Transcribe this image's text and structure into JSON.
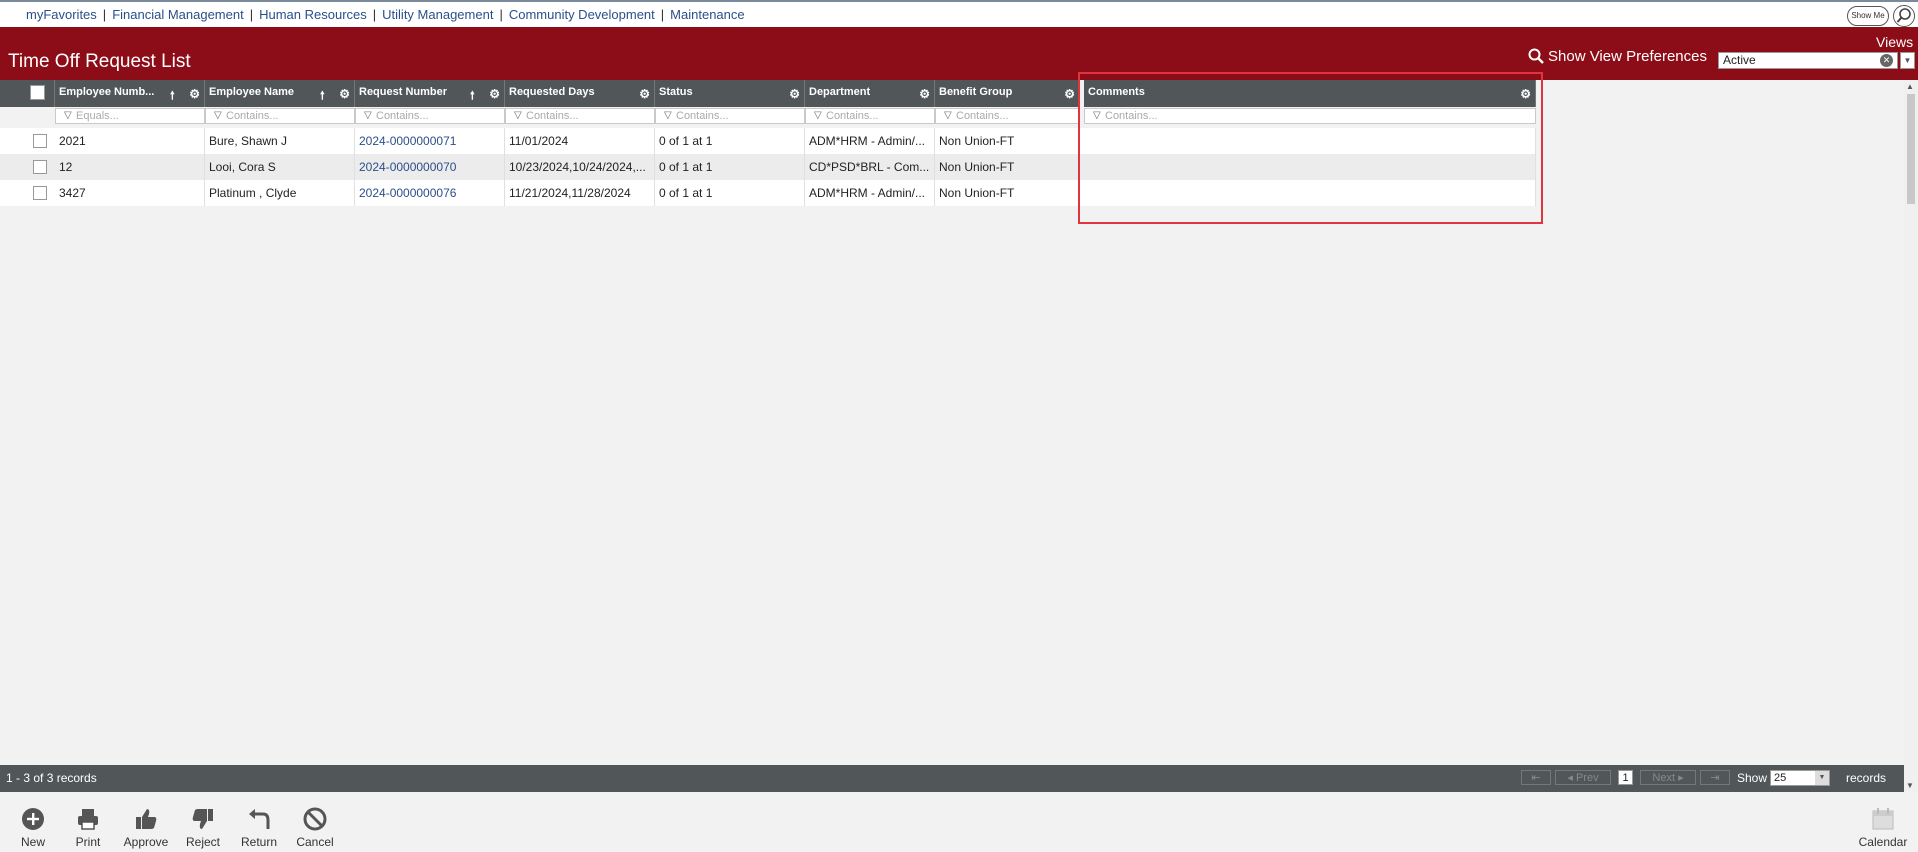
{
  "topnav": {
    "links": [
      "myFavorites",
      "Financial Management",
      "Human Resources",
      "Utility Management",
      "Community Development",
      "Maintenance"
    ],
    "show_me": "Show Me"
  },
  "header": {
    "page_title": "Time Off Request List",
    "views_label": "Views",
    "show_view_preferences": "Show View Preferences",
    "view_selected": "Active"
  },
  "grid": {
    "columns": [
      {
        "label": "Employee Numb...",
        "filter_placeholder": "Equals..."
      },
      {
        "label": "Employee Name",
        "filter_placeholder": "Contains..."
      },
      {
        "label": "Request Number",
        "filter_placeholder": "Contains..."
      },
      {
        "label": "Requested Days",
        "filter_placeholder": "Contains..."
      },
      {
        "label": "Status",
        "filter_placeholder": "Contains..."
      },
      {
        "label": "Department",
        "filter_placeholder": "Contains..."
      },
      {
        "label": "Benefit Group",
        "filter_placeholder": "Contains..."
      },
      {
        "label": "Comments",
        "filter_placeholder": "Contains..."
      }
    ],
    "rows": [
      {
        "employee_number": "2021",
        "employee_name": "Bure, Shawn J",
        "request_number": "2024-0000000071",
        "requested_days": "11/01/2024",
        "status": "0 of 1 at 1",
        "department": "ADM*HRM - Admin/...",
        "benefit_group": "Non Union-FT",
        "comments": ""
      },
      {
        "employee_number": "12",
        "employee_name": "Looi, Cora S",
        "request_number": "2024-0000000070",
        "requested_days": "10/23/2024,10/24/2024,...",
        "status": "0 of 1 at 1",
        "department": "CD*PSD*BRL - Com...",
        "benefit_group": "Non Union-FT",
        "comments": ""
      },
      {
        "employee_number": "3427",
        "employee_name": "Platinum , Clyde",
        "request_number": "2024-0000000076",
        "requested_days": "11/21/2024,11/28/2024",
        "status": "0 of 1 at 1",
        "department": "ADM*HRM - Admin/...",
        "benefit_group": "Non Union-FT",
        "comments": ""
      }
    ]
  },
  "footer": {
    "record_count": "1 - 3 of 3 records",
    "prev": "Prev",
    "next": "Next",
    "current_page": "1",
    "show_label": "Show",
    "page_size": "25",
    "records_label": "records"
  },
  "toolbar": {
    "new": "New",
    "print": "Print",
    "approve": "Approve",
    "reject": "Reject",
    "return": "Return",
    "cancel": "Cancel",
    "calendar": "Calendar"
  },
  "colors": {
    "brand_red": "#8c0d17",
    "header_gray": "#515759",
    "link_blue": "#2b4f8a",
    "highlight_red": "#e0343e"
  }
}
